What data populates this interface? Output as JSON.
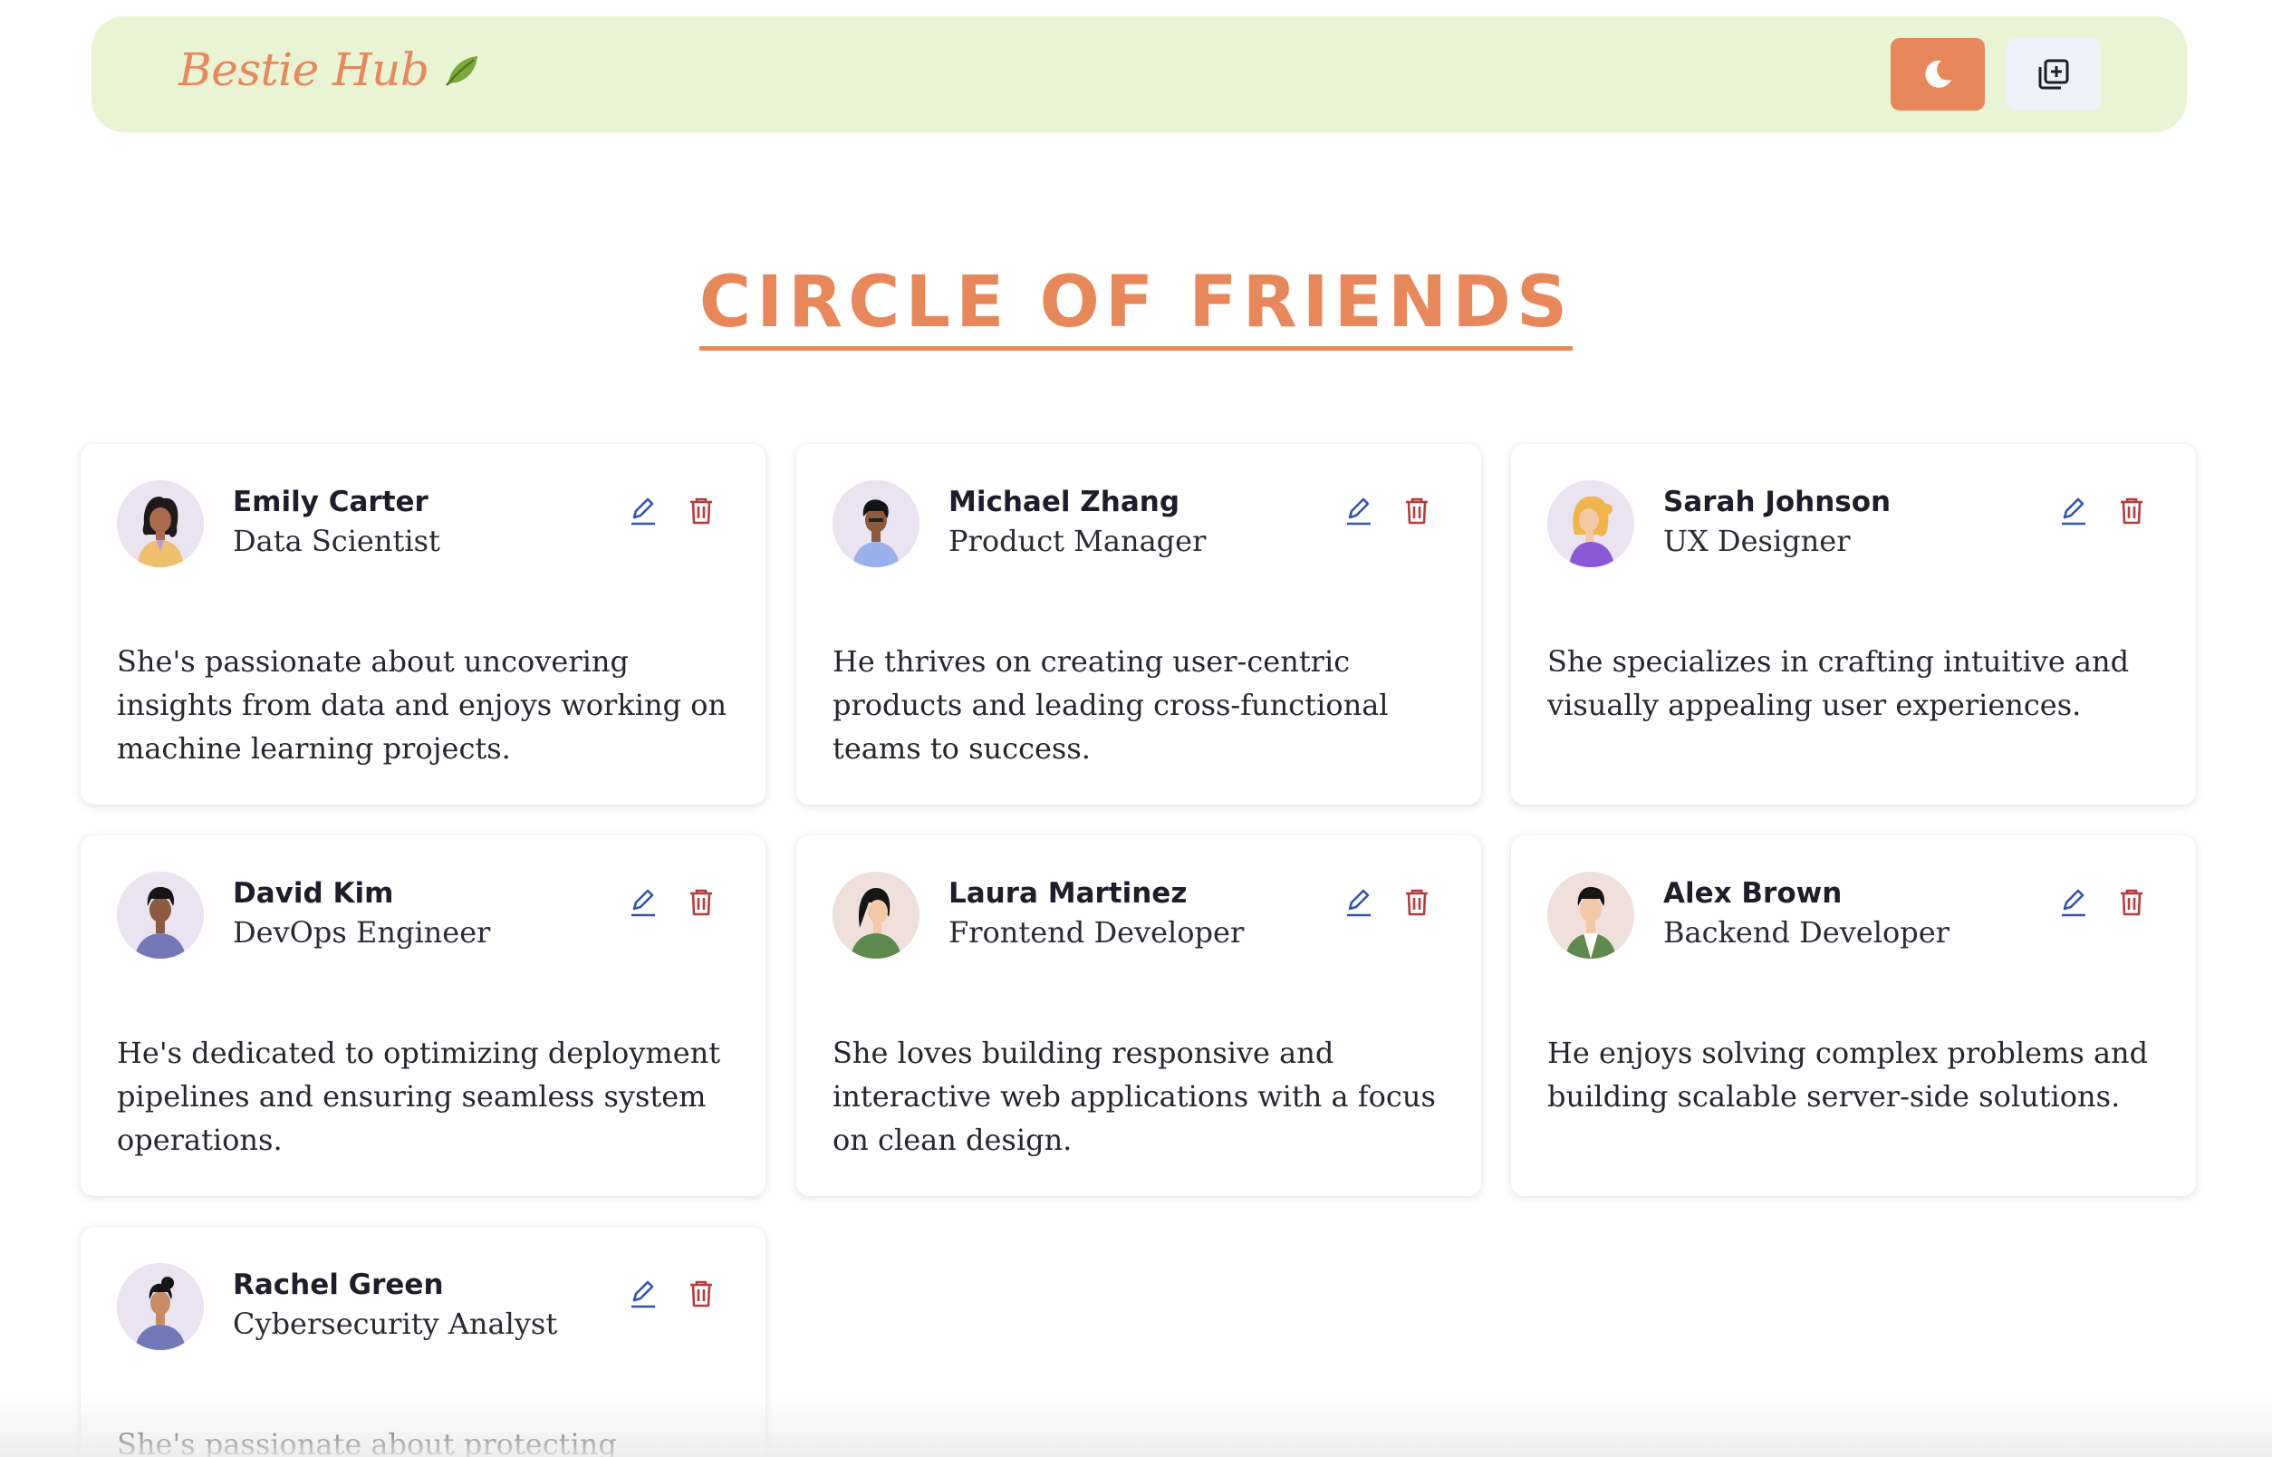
{
  "header": {
    "brand": "Bestie Hub",
    "brand_icon": "leaf-icon",
    "theme_button_icon": "moon-icon",
    "add_button_icon": "add-stack-icon",
    "colors": {
      "navbar_bg": "#e8f4d4",
      "accent": "#e8875a",
      "add_button_bg": "#eef1fa"
    }
  },
  "main": {
    "title": "CIRCLE OF FRIENDS"
  },
  "friends": [
    {
      "name": "Emily Carter",
      "role": "Data Scientist",
      "bio": "She's passionate about uncovering insights from data and enjoys working on machine learning projects."
    },
    {
      "name": "Michael Zhang",
      "role": "Product Manager",
      "bio": "He thrives on creating user-centric products and leading cross-functional teams to success."
    },
    {
      "name": "Sarah Johnson",
      "role": "UX Designer",
      "bio": "She specializes in crafting intuitive and visually appealing user experiences."
    },
    {
      "name": "David Kim",
      "role": "DevOps Engineer",
      "bio": "He's dedicated to optimizing deployment pipelines and ensuring seamless system operations."
    },
    {
      "name": "Laura Martinez",
      "role": "Frontend Developer",
      "bio": "She loves building responsive and interactive web applications with a focus on clean design."
    },
    {
      "name": "Alex Brown",
      "role": "Backend Developer",
      "bio": "He enjoys solving complex problems and building scalable server-side solutions."
    },
    {
      "name": "Rachel Green",
      "role": "Cybersecurity Analyst",
      "bio": "She's passionate about protecting systems"
    }
  ],
  "card_actions": {
    "edit_icon": "pencil-icon",
    "delete_icon": "trash-icon",
    "edit_color": "#2f55b0",
    "delete_color": "#b83a3a"
  }
}
